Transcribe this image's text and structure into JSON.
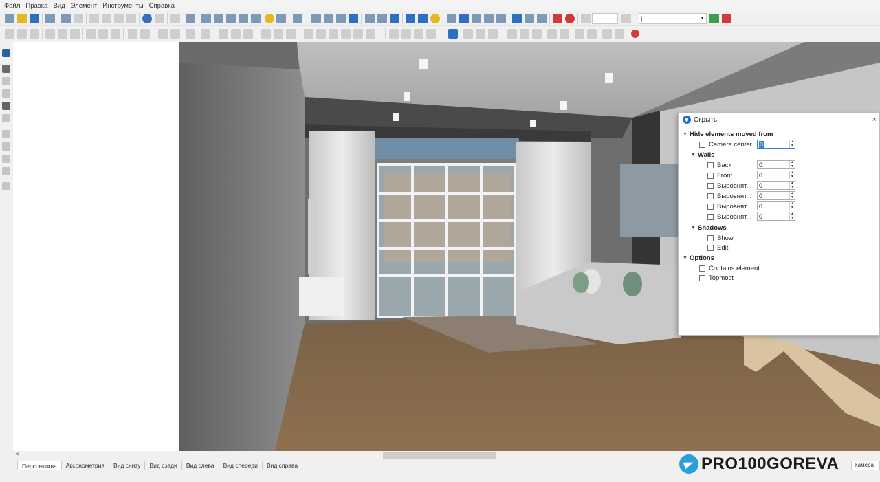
{
  "menu": [
    "Файл",
    "Правка",
    "Вид",
    "Элемент",
    "Инструменты",
    "Справка"
  ],
  "toolbar": {
    "zoom_value": "",
    "layer_value": "|"
  },
  "dialog": {
    "title": "Скрыть",
    "close": "×",
    "hide_group": "Hide elements moved from",
    "camera_center": {
      "label": "Camera center",
      "value": "0"
    },
    "walls_group": "Walls",
    "walls": [
      {
        "label": "Back",
        "value": "0"
      },
      {
        "label": "Front",
        "value": "0"
      },
      {
        "label": "Выровнят...",
        "value": "0"
      },
      {
        "label": "Выровнят...",
        "value": "0"
      },
      {
        "label": "Выровнят...",
        "value": "0"
      },
      {
        "label": "Выровнят...",
        "value": "0"
      }
    ],
    "shadows_group": "Shadows",
    "shadows": [
      "Show",
      "Edit"
    ],
    "options_group": "Options",
    "options": [
      "Contains element",
      "Topmost"
    ]
  },
  "tabs": [
    "Перспектива",
    "Аксонометрия",
    "Вид снизу",
    "Вид сзади",
    "Вид слева",
    "Вид спереди",
    "Вид справа"
  ],
  "watermark": "PRO100GOREVA",
  "camera_button": "Камера",
  "scroll_left": "<",
  "icons": {
    "tg": "telegram-icon"
  }
}
